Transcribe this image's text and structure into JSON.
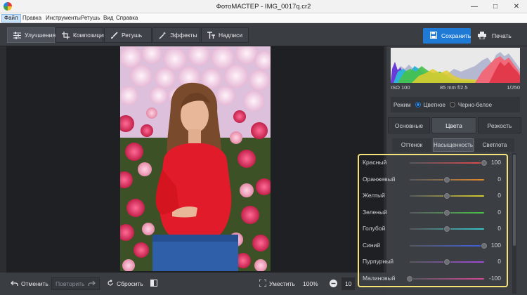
{
  "window": {
    "title": "ФотоМАСТЕР - IMG_0017q.cr2"
  },
  "menu": [
    "Файл",
    "Правка",
    "Инструменты",
    "Ретушь",
    "Вид",
    "Справка"
  ],
  "tabs": [
    {
      "label": "Улучшения",
      "icon": "sliders-icon"
    },
    {
      "label": "Композиция",
      "icon": "crop-icon"
    },
    {
      "label": "Ретушь",
      "icon": "brush-icon"
    },
    {
      "label": "Эффекты",
      "icon": "magic-wand-icon"
    },
    {
      "label": "Надписи",
      "icon": "text-icon"
    }
  ],
  "actions": {
    "save": "Сохранить",
    "print": "Печать"
  },
  "bottom": {
    "undo": "Отменить",
    "redo": "Повторить",
    "reset": "Сбросить",
    "fit": "Уместить",
    "zoom": "100%",
    "zoom2": "10"
  },
  "histogram": {
    "iso": "ISO 100",
    "lens": "85 mm f/2.5",
    "shutter": "1/250"
  },
  "mode": {
    "label": "Режим",
    "color": "Цветное",
    "bw": "Черно-белое"
  },
  "subtabs": [
    "Основные",
    "Цвета",
    "Резкость"
  ],
  "colortabs": [
    "Оттенок",
    "Насыщенность",
    "Светлота"
  ],
  "sliders": [
    {
      "label": "Красный",
      "value": "100",
      "level": 1,
      "color": "#e04a4a"
    },
    {
      "label": "Оранжевый",
      "value": "0",
      "level": 0.5,
      "color": "#e58a2b"
    },
    {
      "label": "Желтый",
      "value": "0",
      "level": 0.5,
      "color": "#d9cc2e"
    },
    {
      "label": "Зеленый",
      "value": "0",
      "level": 0.5,
      "color": "#4cc24a"
    },
    {
      "label": "Голубой",
      "value": "0",
      "level": 0.5,
      "color": "#37c5c8"
    },
    {
      "label": "Синий",
      "value": "100",
      "level": 1,
      "color": "#3f5fe0"
    },
    {
      "label": "Пурпурный",
      "value": "0",
      "level": 0.5,
      "color": "#a24ad9"
    },
    {
      "label": "Малиновый",
      "value": "-100",
      "level": 0,
      "color": "#d9489a"
    }
  ]
}
